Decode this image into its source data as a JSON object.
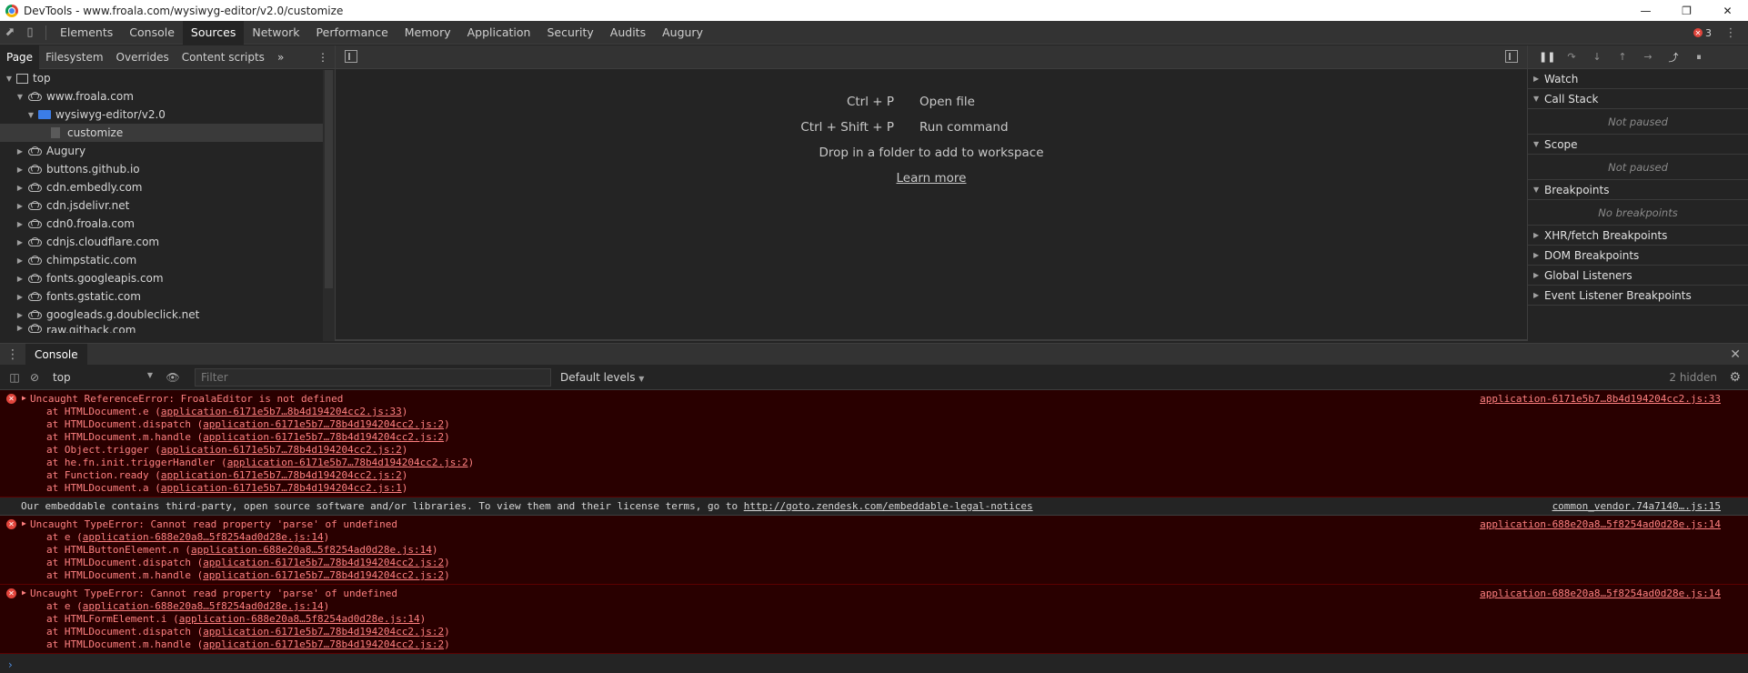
{
  "window": {
    "title": "DevTools - www.froala.com/wysiwyg-editor/v2.0/customize"
  },
  "main_tabs": [
    {
      "label": "Elements"
    },
    {
      "label": "Console"
    },
    {
      "label": "Sources"
    },
    {
      "label": "Network"
    },
    {
      "label": "Performance"
    },
    {
      "label": "Memory"
    },
    {
      "label": "Application"
    },
    {
      "label": "Security"
    },
    {
      "label": "Audits"
    },
    {
      "label": "Augury"
    }
  ],
  "active_main_tab": "Sources",
  "error_count": "3",
  "navigator": {
    "tabs": [
      {
        "label": "Page"
      },
      {
        "label": "Filesystem"
      },
      {
        "label": "Overrides"
      },
      {
        "label": "Content scripts"
      }
    ],
    "tree": [
      {
        "label": "top"
      },
      {
        "label": "www.froala.com"
      },
      {
        "label": "wysiwyg-editor/v2.0"
      },
      {
        "label": "customize"
      },
      {
        "label": "Augury"
      },
      {
        "label": "buttons.github.io"
      },
      {
        "label": "cdn.embedly.com"
      },
      {
        "label": "cdn.jsdelivr.net"
      },
      {
        "label": "cdn0.froala.com"
      },
      {
        "label": "cdnjs.cloudflare.com"
      },
      {
        "label": "chimpstatic.com"
      },
      {
        "label": "fonts.googleapis.com"
      },
      {
        "label": "fonts.gstatic.com"
      },
      {
        "label": "googleads.g.doubleclick.net"
      },
      {
        "label": "raw.githack.com"
      }
    ]
  },
  "editor": {
    "open_file_key": "Ctrl + P",
    "open_file_label": "Open file",
    "run_command_key": "Ctrl + Shift + P",
    "run_command_label": "Run command",
    "drop_text": "Drop in a folder to add to workspace",
    "learn_more": "Learn more"
  },
  "debugger": {
    "watch": "Watch",
    "call_stack": "Call Stack",
    "call_stack_status": "Not paused",
    "scope": "Scope",
    "scope_status": "Not paused",
    "breakpoints": "Breakpoints",
    "breakpoints_status": "No breakpoints",
    "xhr": "XHR/fetch Breakpoints",
    "dom": "DOM Breakpoints",
    "global": "Global Listeners",
    "event": "Event Listener Breakpoints"
  },
  "drawer": {
    "tab": "Console"
  },
  "console_toolbar": {
    "context": "top",
    "filter_placeholder": "Filter",
    "levels": "Default levels",
    "hidden": "2 hidden"
  },
  "messages": {
    "m1": {
      "head": "Uncaught ReferenceError: FroalaEditor is not defined",
      "source": "application-6171e5b7…8b4d194204cc2.js:33",
      "stack": [
        {
          "pre": "at HTMLDocument.e (",
          "link": "application-6171e5b7…8b4d194204cc2.js:33",
          "post": ")"
        },
        {
          "pre": "at HTMLDocument.dispatch (",
          "link": "application-6171e5b7…78b4d194204cc2.js:2",
          "post": ")"
        },
        {
          "pre": "at HTMLDocument.m.handle (",
          "link": "application-6171e5b7…78b4d194204cc2.js:2",
          "post": ")"
        },
        {
          "pre": "at Object.trigger (",
          "link": "application-6171e5b7…78b4d194204cc2.js:2",
          "post": ")"
        },
        {
          "pre": "at he.fn.init.triggerHandler (",
          "link": "application-6171e5b7…78b4d194204cc2.js:2",
          "post": ")"
        },
        {
          "pre": "at Function.ready (",
          "link": "application-6171e5b7…78b4d194204cc2.js:2",
          "post": ")"
        },
        {
          "pre": "at HTMLDocument.a (",
          "link": "application-6171e5b7…78b4d194204cc2.js:1",
          "post": ")"
        }
      ]
    },
    "m2": {
      "pre": "Our embeddable contains third-party, open source software and/or libraries. To view them and their license terms, go to ",
      "link": "http://goto.zendesk.com/embeddable-legal-notices",
      "source": "common_vendor.74a7140….js:15"
    },
    "m3": {
      "head": "Uncaught TypeError: Cannot read property 'parse' of undefined",
      "source": "application-688e20a8…5f8254ad0d28e.js:14",
      "stack": [
        {
          "pre": "at e (",
          "link": "application-688e20a8…5f8254ad0d28e.js:14",
          "post": ")"
        },
        {
          "pre": "at HTMLButtonElement.n (",
          "link": "application-688e20a8…5f8254ad0d28e.js:14",
          "post": ")"
        },
        {
          "pre": "at HTMLDocument.dispatch (",
          "link": "application-6171e5b7…78b4d194204cc2.js:2",
          "post": ")"
        },
        {
          "pre": "at HTMLDocument.m.handle (",
          "link": "application-6171e5b7…78b4d194204cc2.js:2",
          "post": ")"
        }
      ]
    },
    "m4": {
      "head": "Uncaught TypeError: Cannot read property 'parse' of undefined",
      "source": "application-688e20a8…5f8254ad0d28e.js:14",
      "stack": [
        {
          "pre": "at e (",
          "link": "application-688e20a8…5f8254ad0d28e.js:14",
          "post": ")"
        },
        {
          "pre": "at HTMLFormElement.i (",
          "link": "application-688e20a8…5f8254ad0d28e.js:14",
          "post": ")"
        },
        {
          "pre": "at HTMLDocument.dispatch (",
          "link": "application-6171e5b7…78b4d194204cc2.js:2",
          "post": ")"
        },
        {
          "pre": "at HTMLDocument.m.handle (",
          "link": "application-6171e5b7…78b4d194204cc2.js:2",
          "post": ")"
        }
      ]
    }
  },
  "colors": {
    "error_background": "#290000",
    "error_text": "#ff8080",
    "accent_blue": "#3b7de8"
  }
}
